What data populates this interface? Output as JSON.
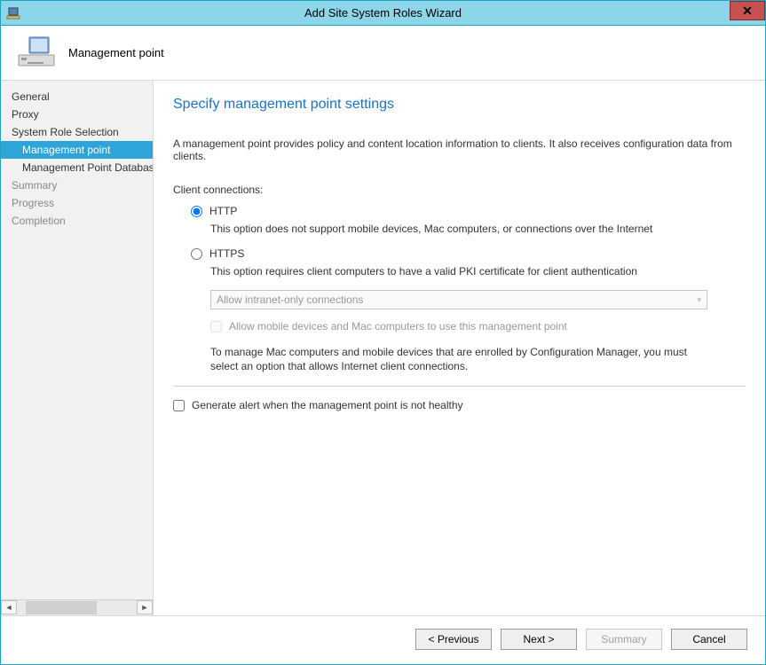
{
  "window": {
    "title": "Add Site System Roles Wizard"
  },
  "header": {
    "label": "Management point"
  },
  "sidebar": {
    "items": [
      {
        "label": "General"
      },
      {
        "label": "Proxy"
      },
      {
        "label": "System Role Selection"
      },
      {
        "label": "Management point"
      },
      {
        "label": "Management Point Database"
      },
      {
        "label": "Summary"
      },
      {
        "label": "Progress"
      },
      {
        "label": "Completion"
      }
    ]
  },
  "content": {
    "title": "Specify management point settings",
    "intro": "A management point provides policy and content location information to clients.  It also receives configuration data from clients.",
    "clientConnectionsLabel": "Client connections:",
    "httpLabel": "HTTP",
    "httpDesc": "This option does not support mobile devices, Mac computers, or connections over the Internet",
    "httpsLabel": "HTTPS",
    "httpsDesc": "This option requires client computers to have a valid PKI certificate for client authentication",
    "dropdownValue": "Allow intranet-only connections",
    "allowMobileLabel": "Allow mobile devices and Mac computers to use this management point",
    "infoText": "To manage Mac computers and mobile devices that are enrolled by Configuration Manager, you must select an option that allows Internet client connections.",
    "generateAlertLabel": "Generate alert when the management point is not healthy"
  },
  "footer": {
    "previous": "< Previous",
    "next": "Next >",
    "summary": "Summary",
    "cancel": "Cancel"
  }
}
